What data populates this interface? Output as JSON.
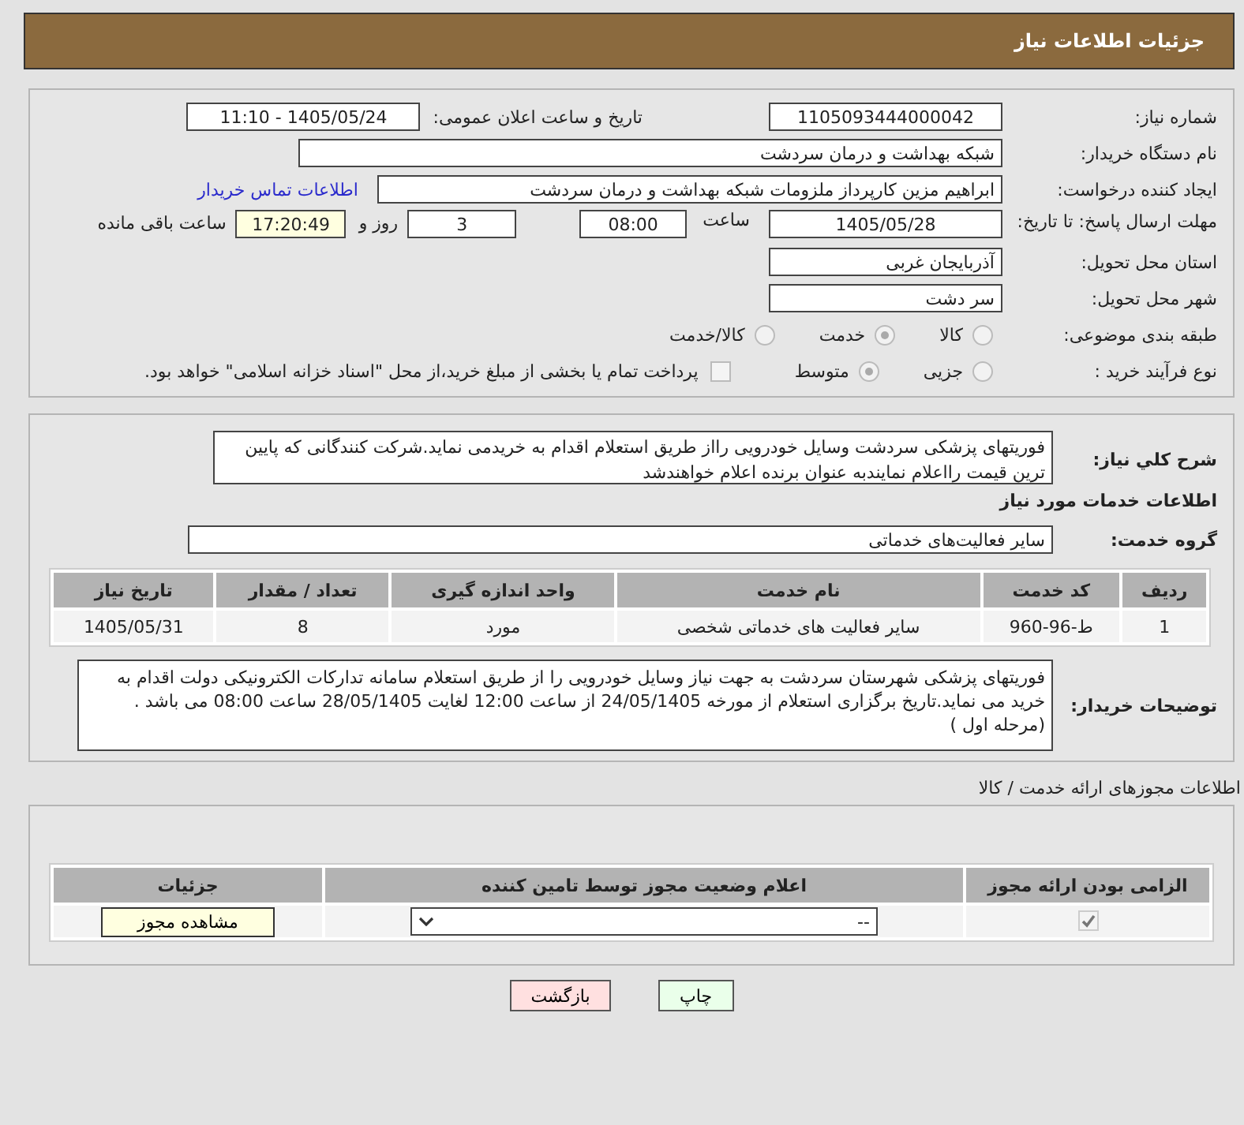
{
  "header": {
    "title": "جزئیات اطلاعات نیاز"
  },
  "need_number": {
    "label": "شماره نیاز:",
    "value": "1105093444000042"
  },
  "announce": {
    "label": "تاریخ و ساعت اعلان عمومی:",
    "value": "1405/05/24 - 11:10"
  },
  "buyer": {
    "label": "نام دستگاه خریدار:",
    "value": "شبکه بهداشت و درمان سردشت"
  },
  "requester": {
    "label": "ایجاد کننده درخواست:",
    "value": "ابراهیم مزین کارپرداز ملزومات  شبکه بهداشت و درمان سردشت",
    "link": "اطلاعات تماس خریدار"
  },
  "deadline": {
    "label": "مهلت ارسال پاسخ: تا تاریخ:",
    "date": "1405/05/28",
    "time_label": "ساعت",
    "time": "08:00",
    "days": "3",
    "days_label": "روز و",
    "remaining": "17:20:49",
    "remaining_label": "ساعت باقی مانده"
  },
  "province": {
    "label": "استان محل تحویل:",
    "value": "آذربایجان غربی"
  },
  "city": {
    "label": "شهر محل تحویل:",
    "value": "سر دشت"
  },
  "category": {
    "label": "طبقه بندی موضوعی:",
    "options": [
      {
        "label": "کالا",
        "selected": false
      },
      {
        "label": "خدمت",
        "selected": true
      },
      {
        "label": "کالا/خدمت",
        "selected": false
      }
    ]
  },
  "process": {
    "label": "نوع فرآیند خرید :",
    "options": [
      {
        "label": "جزیی",
        "selected": false
      },
      {
        "label": "متوسط",
        "selected": true
      }
    ],
    "payment": {
      "checked": false,
      "label": "پرداخت تمام یا بخشی از مبلغ خرید،از محل \"اسناد خزانه اسلامی\" خواهد بود."
    }
  },
  "description": {
    "label": "شرح کلي نیاز:",
    "value": "فوریتهای پزشکی سردشت وسایل خودرویی رااز طریق استعلام اقدام به خریدمی نماید.شرکت کنندگانی که پایین ترین قیمت رااعلام نمایندبه عنوان برنده اعلام خواهندشد"
  },
  "services_heading": "اطلاعات خدمات مورد نیاز",
  "service_group": {
    "label": "گروه خدمت:",
    "value": "سایر فعالیت‌های خدماتی"
  },
  "services_table": {
    "columns": [
      "ردیف",
      "کد خدمت",
      "نام خدمت",
      "واحد اندازه گیری",
      "تعداد / مقدار",
      "تاریخ نیاز"
    ],
    "rows": [
      [
        "1",
        "ط-96-960",
        "سایر فعالیت های خدماتی شخصی",
        "مورد",
        "8",
        "1405/05/31"
      ]
    ]
  },
  "buyer_notes": {
    "label": "توضیحات خریدار:",
    "value": " فوریتهای پزشکی شهرستان سردشت  به جهت نیاز وسایل خودرویی را از طریق استعلام سامانه تدارکات الکترونیکی دولت اقدام به خرید می نماید.تاریخ برگزاری استعلام از مورخه 24/05/1405 از ساعت 12:00 لغایت 28/05/1405  ساعت 08:00 می باشد .(مرحله اول )"
  },
  "permits_heading": "اطلاعات مجوزهای ارائه خدمت / کالا",
  "permits_table": {
    "columns": [
      "الزامی بودن ارائه مجوز",
      "اعلام وضعیت مجوز توسط تامین کننده",
      "جزئیات"
    ],
    "rows": [
      {
        "required": true,
        "status": "--",
        "action": "مشاهده مجوز"
      }
    ]
  },
  "buttons": [
    {
      "label": "چاپ",
      "kind": "print"
    },
    {
      "label": "بازگشت",
      "kind": "back"
    }
  ]
}
